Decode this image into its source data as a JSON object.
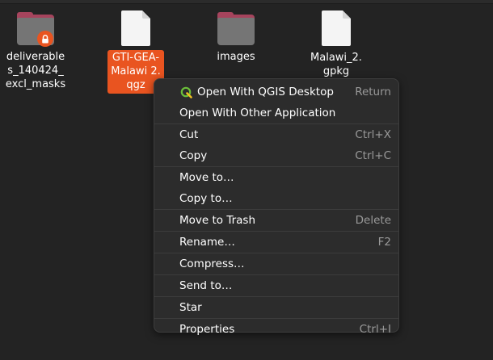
{
  "files": [
    {
      "label": "deliverable\ns_140424_\nexcl_masks",
      "icon": "folder-locked-icon"
    },
    {
      "label": "GTI-GEA-\nMalawi 2.\nqgz",
      "icon": "document-icon",
      "selected": true
    },
    {
      "label": "images",
      "icon": "folder-icon"
    },
    {
      "label": "Malawi_2.\ngpkg",
      "icon": "document-icon"
    }
  ],
  "context_menu": {
    "items": [
      {
        "label": "Open With QGIS Desktop",
        "shortcut": "Return",
        "icon": "qgis-icon"
      },
      {
        "label": "Open With Other Application",
        "shortcut": ""
      },
      {
        "label": "Cut",
        "shortcut": "Ctrl+X"
      },
      {
        "label": "Copy",
        "shortcut": "Ctrl+C"
      },
      {
        "label": "Move to…",
        "shortcut": ""
      },
      {
        "label": "Copy to…",
        "shortcut": ""
      },
      {
        "label": "Move to Trash",
        "shortcut": "Delete"
      },
      {
        "label": "Rename…",
        "shortcut": "F2"
      },
      {
        "label": "Compress…",
        "shortcut": ""
      },
      {
        "label": "Send to…",
        "shortcut": ""
      },
      {
        "label": "Star",
        "shortcut": ""
      },
      {
        "label": "Properties",
        "shortcut": "Ctrl+I"
      }
    ]
  },
  "colors": {
    "selection": "#e95420",
    "folder_body": "#757575",
    "folder_tab": "#a6445d",
    "menu_bg": "#2c2c2c",
    "shortcut_text": "#9a9a9a"
  }
}
